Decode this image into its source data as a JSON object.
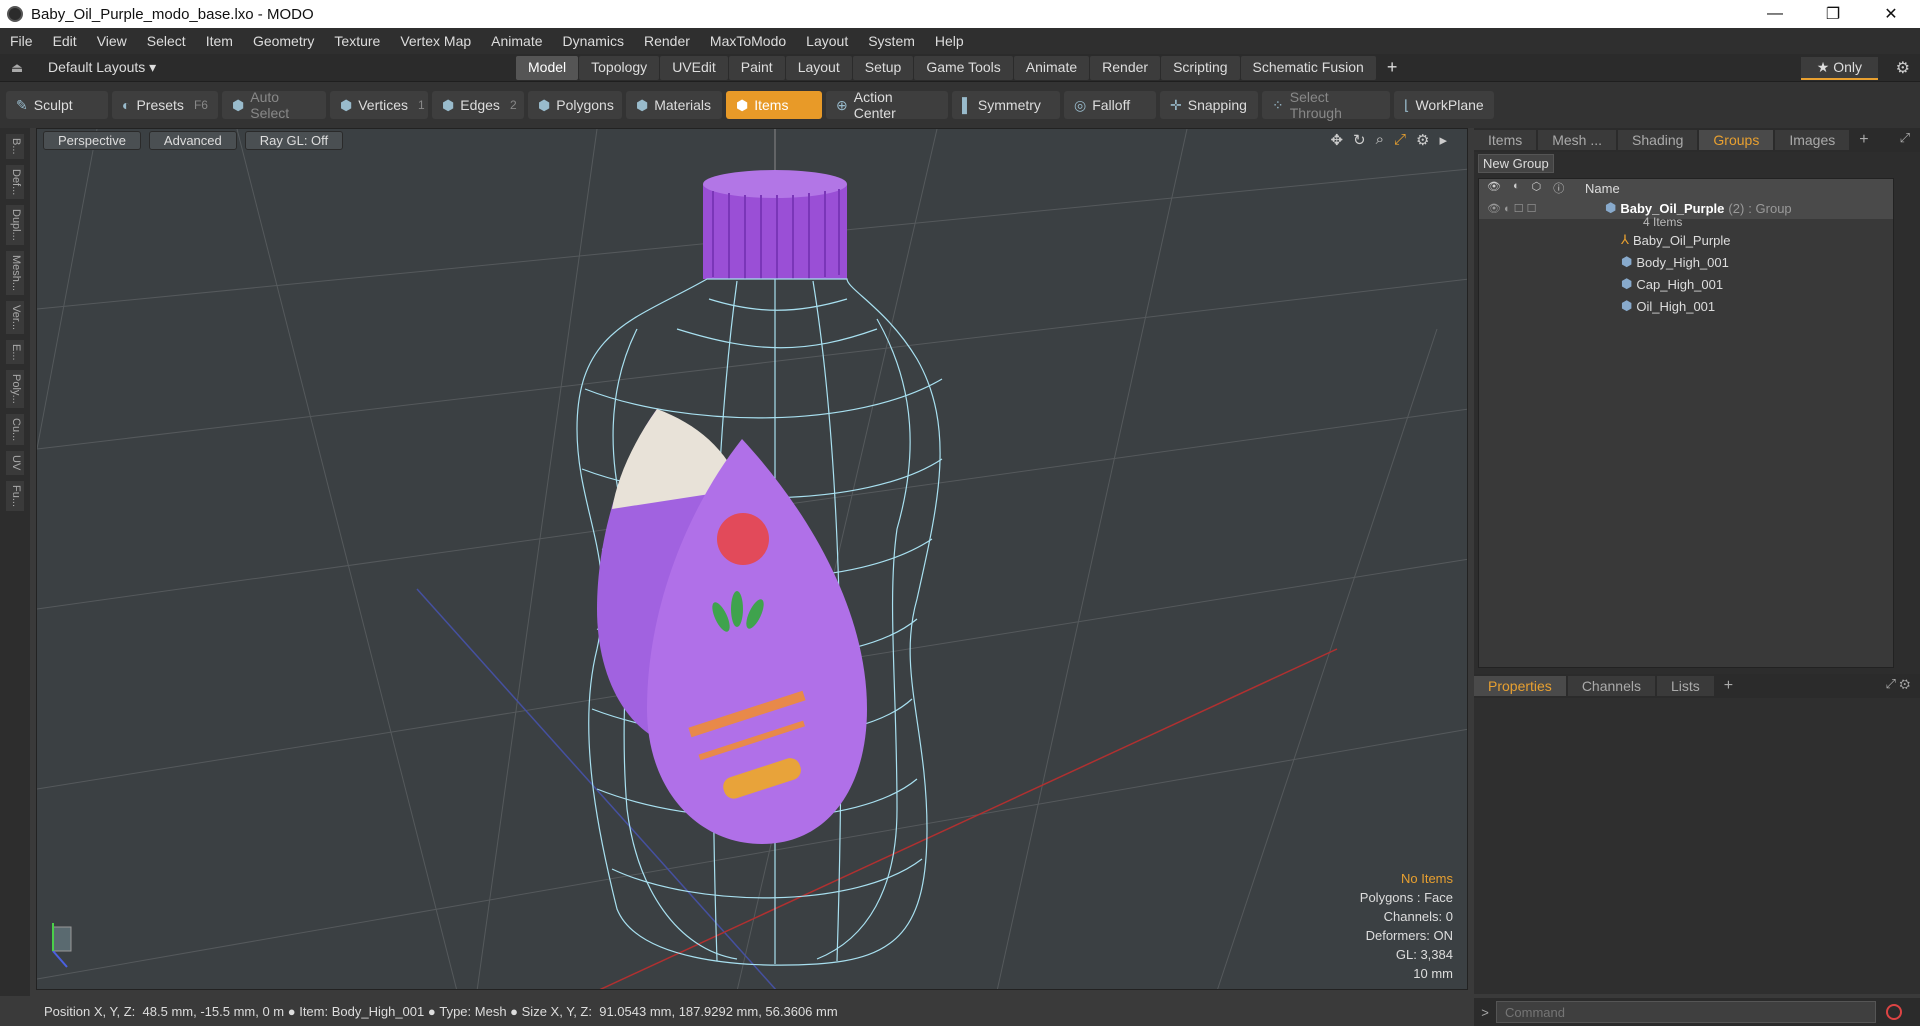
{
  "window": {
    "title": "Baby_Oil_Purple_modo_base.lxo - MODO",
    "minimize": "—",
    "maximize": "❐",
    "close": "✕"
  },
  "menu": [
    "File",
    "Edit",
    "View",
    "Select",
    "Item",
    "Geometry",
    "Texture",
    "Vertex Map",
    "Animate",
    "Dynamics",
    "Render",
    "MaxToModo",
    "Layout",
    "System",
    "Help"
  ],
  "layoutbar": {
    "layouts_label": "Default Layouts ▾",
    "tabs": [
      "Model",
      "Topology",
      "UVEdit",
      "Paint",
      "Layout",
      "Setup",
      "Game Tools",
      "Animate",
      "Render",
      "Scripting",
      "Schematic Fusion"
    ],
    "active_tab": "Model",
    "only_label": "★ Only"
  },
  "toolbar": {
    "sculpt": "Sculpt",
    "presets": "Presets",
    "presets_key": "F6",
    "auto_select": "Auto Select",
    "vertices": "Vertices",
    "vertices_count": "1",
    "edges": "Edges",
    "edges_count": "2",
    "polygons": "Polygons",
    "materials": "Materials",
    "items": "Items",
    "action_center": "Action Center",
    "symmetry": "Symmetry",
    "falloff": "Falloff",
    "snapping": "Snapping",
    "select_through": "Select Through",
    "workplane": "WorkPlane"
  },
  "sidestrip": [
    "B...",
    "Def...",
    "Dupl...",
    "Mesh...",
    "Ver...",
    "E...",
    "Poly...",
    "Cu...",
    "UV",
    "Fu..."
  ],
  "viewport": {
    "perspective": "Perspective",
    "advanced": "Advanced",
    "raygl": "Ray GL: Off",
    "info": {
      "no_items": "No Items",
      "polygons": "Polygons : Face",
      "channels": "Channels: 0",
      "deformers": "Deformers: ON",
      "gl": "GL: 3,384",
      "unit": "10 mm"
    }
  },
  "right_panel": {
    "tabs": [
      "Items",
      "Mesh ...",
      "Shading",
      "Groups",
      "Images"
    ],
    "active_tab": "Groups",
    "new_group": "New Group",
    "col_name": "Name",
    "group_name": "Baby_Oil_Purple",
    "group_count": "(2)",
    "group_type": ": Group",
    "group_items": "4 Items",
    "children": [
      "Baby_Oil_Purple",
      "Body_High_001",
      "Cap_High_001",
      "Oil_High_001"
    ],
    "props_tabs": [
      "Properties",
      "Channels",
      "Lists"
    ],
    "props_active": "Properties"
  },
  "command": {
    "placeholder": "Command"
  },
  "status": {
    "position_label": "Position X, Y, Z:",
    "position_value": "48.5 mm, -15.5 mm, 0 m",
    "item_label": "Item:",
    "item_value": "Body_High_001",
    "type_label": "Type:",
    "type_value": "Mesh",
    "size_label": "Size X, Y, Z:",
    "size_value": "91.0543 mm, 187.9292 mm, 56.3606 mm"
  },
  "colors": {
    "accent": "#e89a28",
    "viewport_bg": "#3b4043",
    "wire": "#a8e0f0",
    "cap": "#9a4fd6"
  }
}
